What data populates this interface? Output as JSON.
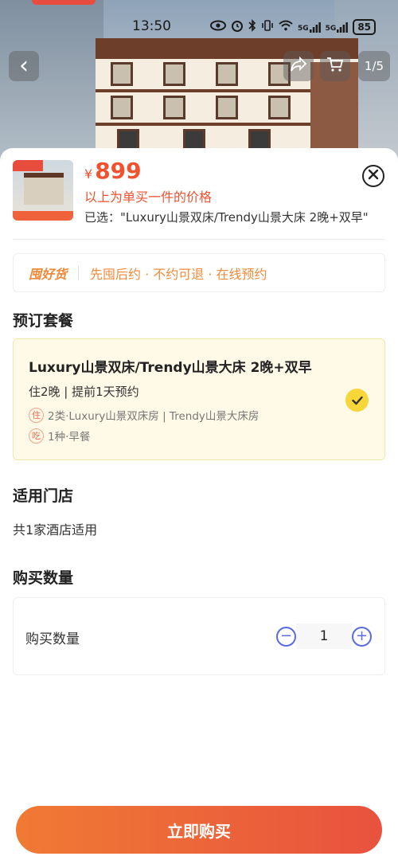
{
  "status_bar": {
    "time": "13:50",
    "battery": "85",
    "network_1": "5G",
    "network_2": "5G"
  },
  "gallery": {
    "page_indicator": "1/5",
    "back_icon": "‹"
  },
  "product": {
    "currency": "¥",
    "price": "899",
    "price_note": "以上为单买一件的价格",
    "selected": "已选：\"Luxury山景双床/Trendy山景大床 2晚+双早\""
  },
  "guarantee": {
    "logo": "囤好货",
    "text": "先囤后约 · 不约可退 · 在线预约"
  },
  "package_section": {
    "title": "预订套餐",
    "card": {
      "name": "Luxury山景双床/Trendy山景大床 2晚+双早",
      "sub": "住2晚 | 提前1天预约",
      "stay_tag": "住",
      "stay_text": "2类·Luxury山景双床房 | Trendy山景大床房",
      "meal_tag": "吃",
      "meal_text": "1种·早餐",
      "selected": true
    }
  },
  "store_section": {
    "title": "适用门店",
    "text": "共1家酒店适用"
  },
  "quantity_section": {
    "title": "购买数量",
    "label": "购买数量",
    "value": "1",
    "minus": "−",
    "plus": "+"
  },
  "buy_button": {
    "label": "立即购买"
  },
  "colors": {
    "price": "#f0522f",
    "accent_orange": "#f08a3a",
    "check_yellow": "#f7d63a",
    "stepper_blue": "#5a6be0",
    "buy_start": "#f07a34",
    "buy_end": "#e8523e"
  }
}
